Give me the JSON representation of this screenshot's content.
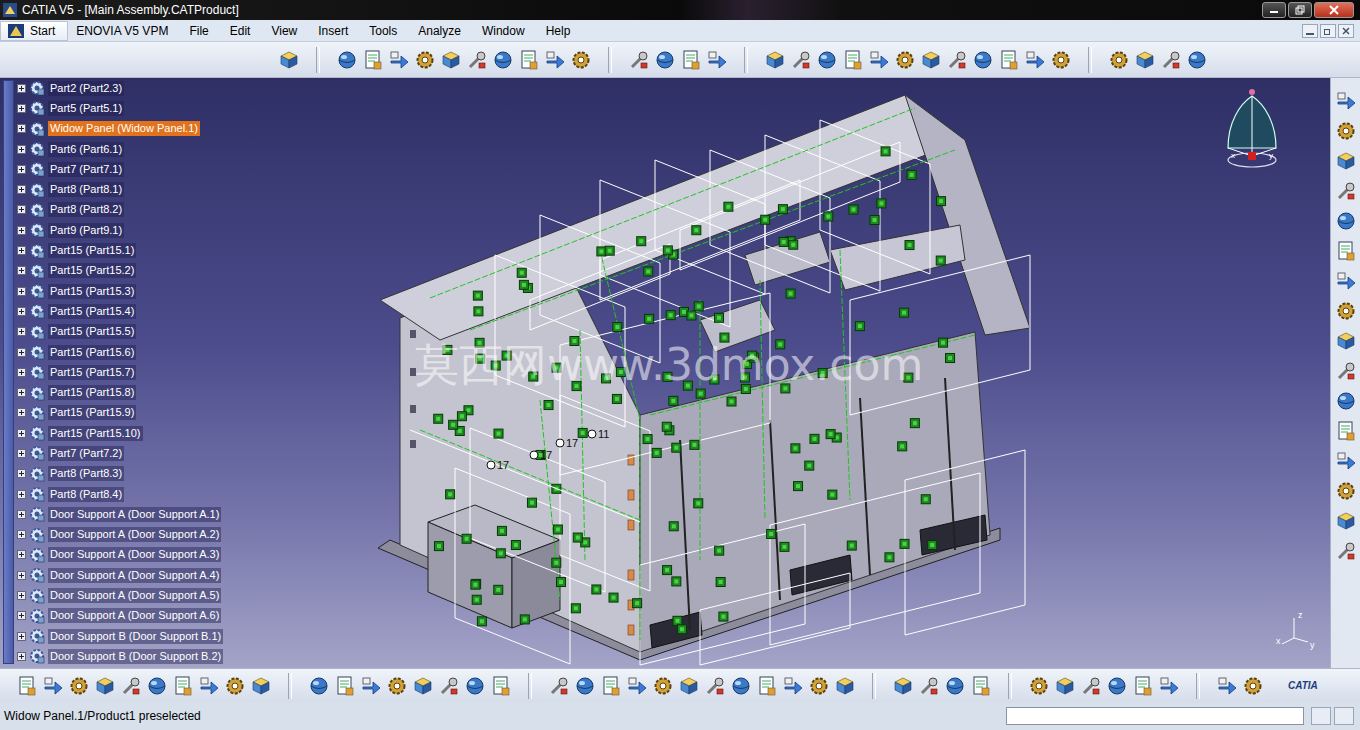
{
  "window": {
    "title": "CATIA V5 - [Main Assembly.CATProduct]",
    "brand": "CATIA"
  },
  "menu": [
    {
      "label": "Start",
      "kind": "start",
      "selected": true
    },
    {
      "label": "ENOVIA V5 VPM",
      "kind": "menu",
      "selected": false
    },
    {
      "label": "File",
      "kind": "menu",
      "selected": false
    },
    {
      "label": "Edit",
      "kind": "menu",
      "selected": false
    },
    {
      "label": "View",
      "kind": "menu",
      "selected": false
    },
    {
      "label": "Insert",
      "kind": "menu",
      "selected": false
    },
    {
      "label": "Tools",
      "kind": "menu",
      "selected": false
    },
    {
      "label": "Analyze",
      "kind": "menu",
      "selected": false
    },
    {
      "label": "Window",
      "kind": "menu",
      "selected": false
    },
    {
      "label": "Help",
      "kind": "menu",
      "selected": false
    }
  ],
  "tree": {
    "items": [
      {
        "label": "Part2 (Part2.3)",
        "selected": false,
        "expanded": false
      },
      {
        "label": "Part5 (Part5.1)",
        "selected": false,
        "expanded": false
      },
      {
        "label": "Widow Panel (Widow Panel.1)",
        "selected": true,
        "expanded": false
      },
      {
        "label": "Part6 (Part6.1)",
        "selected": false,
        "expanded": false
      },
      {
        "label": "Part7 (Part7.1)",
        "selected": false,
        "expanded": false
      },
      {
        "label": "Part8 (Part8.1)",
        "selected": false,
        "expanded": false
      },
      {
        "label": "Part8 (Part8.2)",
        "selected": false,
        "expanded": false
      },
      {
        "label": "Part9 (Part9.1)",
        "selected": false,
        "expanded": false
      },
      {
        "label": "Part15 (Part15.1)",
        "selected": false,
        "expanded": false
      },
      {
        "label": "Part15 (Part15.2)",
        "selected": false,
        "expanded": false
      },
      {
        "label": "Part15 (Part15.3)",
        "selected": false,
        "expanded": false
      },
      {
        "label": "Part15 (Part15.4)",
        "selected": false,
        "expanded": false
      },
      {
        "label": "Part15 (Part15.5)",
        "selected": false,
        "expanded": false
      },
      {
        "label": "Part15 (Part15.6)",
        "selected": false,
        "expanded": false
      },
      {
        "label": "Part15 (Part15.7)",
        "selected": false,
        "expanded": false
      },
      {
        "label": "Part15 (Part15.8)",
        "selected": false,
        "expanded": false
      },
      {
        "label": "Part15 (Part15.9)",
        "selected": false,
        "expanded": false
      },
      {
        "label": "Part15 (Part15.10)",
        "selected": false,
        "expanded": false
      },
      {
        "label": "Part7 (Part7.2)",
        "selected": false,
        "expanded": false
      },
      {
        "label": "Part8 (Part8.3)",
        "selected": false,
        "expanded": false
      },
      {
        "label": "Part8 (Part8.4)",
        "selected": false,
        "expanded": false
      },
      {
        "label": "Door Support A (Door Support A.1)",
        "selected": false,
        "expanded": false
      },
      {
        "label": "Door Support A (Door Support A.2)",
        "selected": false,
        "expanded": false
      },
      {
        "label": "Door Support A (Door Support A.3)",
        "selected": false,
        "expanded": false
      },
      {
        "label": "Door Support A (Door Support A.4)",
        "selected": false,
        "expanded": false
      },
      {
        "label": "Door Support A (Door Support A.5)",
        "selected": false,
        "expanded": false
      },
      {
        "label": "Door Support A (Door Support A.6)",
        "selected": false,
        "expanded": false
      },
      {
        "label": "Door Support B (Door Support B.1)",
        "selected": false,
        "expanded": false
      },
      {
        "label": "Door Support B (Door Support B.2)",
        "selected": false,
        "expanded": false
      }
    ]
  },
  "viewport": {
    "watermark": "莫西网www.3dmox.com",
    "dimension_labels": [
      "17",
      "17",
      "17",
      "11"
    ],
    "compass_labels": [
      "x",
      "y"
    ],
    "axis_labels": [
      "z",
      "x",
      "y"
    ]
  },
  "status_bar": {
    "message": "Widow Panel.1/Product1 preselected"
  }
}
